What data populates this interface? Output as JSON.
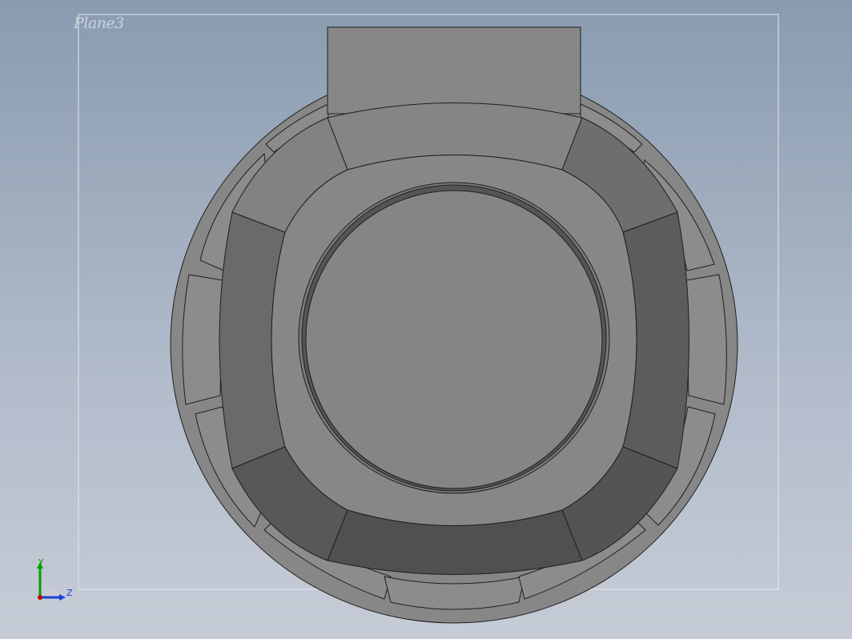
{
  "plane": {
    "label": "Plane3"
  },
  "triad": {
    "y_label": "Y",
    "z_label": "Z",
    "y_color": "#00a000",
    "z_color": "#1a3fd6",
    "origin_color": "#c00000"
  },
  "colors": {
    "background_top": "#8a9bb0",
    "background_bottom": "#c6ccd6",
    "part_light": "#878787",
    "part_mid": "#7d7d7d",
    "part_dark": "#5a5a5a",
    "part_darker": "#4e4e4e",
    "edge": "#1e1e1e"
  }
}
